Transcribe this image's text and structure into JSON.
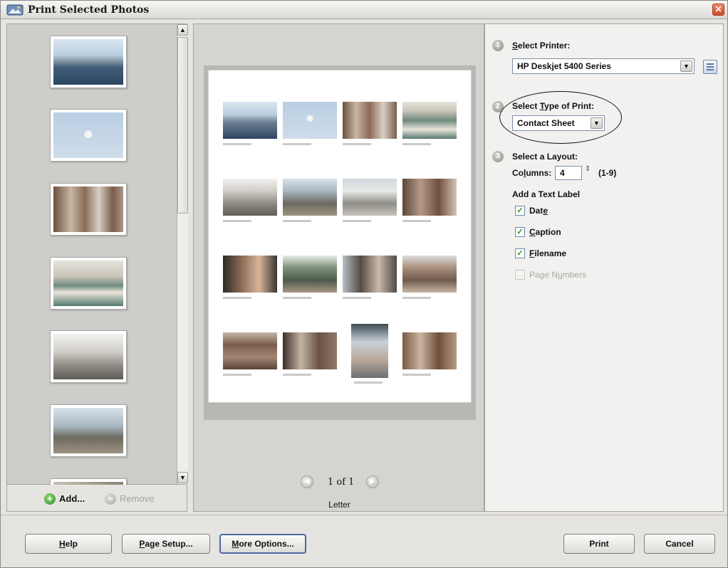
{
  "window": {
    "title": "Print Selected Photos",
    "close_glyph": "✕"
  },
  "thumbnails": {
    "items": [
      {
        "icon": "photo-beach-sea"
      },
      {
        "icon": "photo-parasail"
      },
      {
        "icon": "photo-people-patio"
      },
      {
        "icon": "photo-boats-harbor"
      },
      {
        "icon": "photo-people-dock"
      },
      {
        "icon": "photo-marina-people"
      }
    ],
    "scroll_up": "▲",
    "scroll_down": "▼",
    "add_label": "Add...",
    "remove_label": "Remove",
    "add_glyph": "+",
    "remove_glyph": "−"
  },
  "preview": {
    "page_indicator": "1 of 1",
    "paper": "Letter",
    "prev_glyph": "◀",
    "next_glyph": "▶"
  },
  "settings": {
    "step1_num": "1",
    "step2_num": "2",
    "step3_num": "3",
    "select_printer_label_u": "S",
    "select_printer_label_rest": "elect Printer:",
    "printer_value": "HP Deskjet 5400 Series",
    "type_label_a": "Select ",
    "type_label_u": "T",
    "type_label_b": "ype of Print:",
    "print_type_value": "Contact Sheet",
    "layout_label": "Select a Layout:",
    "columns_label_a": "Co",
    "columns_label_u": "l",
    "columns_label_b": "umns:",
    "columns_value": "4",
    "columns_range": "(1-9)",
    "text_label_heading": "Add a Text Label",
    "date_a": "Dat",
    "date_u": "e",
    "caption_u": "C",
    "caption_b": "aption",
    "filename_u": "F",
    "filename_b": "ilename",
    "page_numbers_a": "Page N",
    "page_numbers_u": "u",
    "page_numbers_b": "mbers",
    "check": "✓",
    "dropdown_glyph": "▼",
    "spin_glyph": "⇕",
    "options": {
      "date": true,
      "caption": true,
      "filename": true,
      "page_numbers": false
    }
  },
  "buttons": {
    "help_u": "H",
    "help_b": "elp",
    "page_setup_u": "P",
    "page_setup_b": "age Setup...",
    "more_options_u": "M",
    "more_options_b": "ore Options...",
    "print": "Print",
    "cancel": "Cancel"
  }
}
